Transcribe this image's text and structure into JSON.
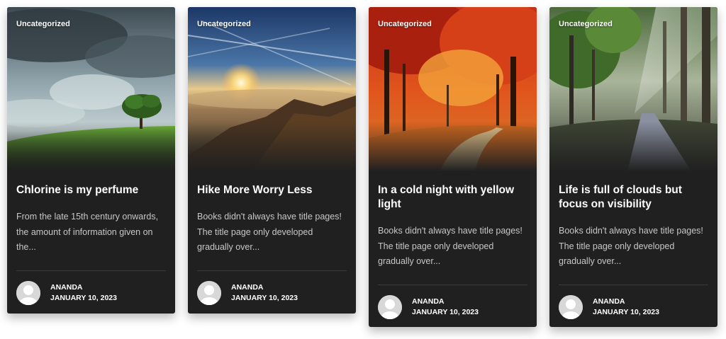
{
  "posts": [
    {
      "category": "Uncategorized",
      "title": "Chlorine is my perfume",
      "excerpt": "From the late 15th century onwards, the amount of information given on the...",
      "author": "ANANDA",
      "date": "JANUARY 10, 2023",
      "image": "green-hill-tree-storm-sky"
    },
    {
      "category": "Uncategorized",
      "title": "Hike More Worry Less",
      "excerpt": "Books didn't always have title pages! The title page only developed gradually over...",
      "author": "ANANDA",
      "date": "JANUARY 10, 2023",
      "image": "mountain-sunset-above-clouds"
    },
    {
      "category": "Uncategorized",
      "title": "In a cold night with yellow light",
      "excerpt": "Books didn't always have title pages! The title page only developed gradually over...",
      "author": "ANANDA",
      "date": "JANUARY 10, 2023",
      "image": "autumn-red-forest-path"
    },
    {
      "category": "Uncategorized",
      "title": "Life is full of clouds but focus on visibility",
      "excerpt": "Books didn't always have title pages! The title page only developed gradually over...",
      "author": "ANANDA",
      "date": "JANUARY 10, 2023",
      "image": "misty-forest-road"
    }
  ],
  "colors": {
    "card_background": "#202020",
    "excerpt_text": "#c7c7c7",
    "divider": "#3a3a3a",
    "avatar_background": "#d8d8d8"
  }
}
